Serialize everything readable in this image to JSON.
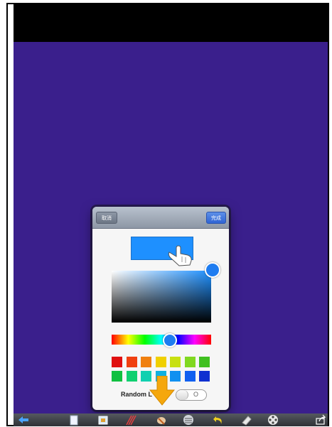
{
  "popover": {
    "cancel_label": "取消",
    "done_label": "完成",
    "selected_color": "#1e90ff",
    "random_label": "Random L",
    "toggle_state": "O"
  },
  "swatches": {
    "row1": [
      "#e01010",
      "#f04010",
      "#f08010",
      "#f0d000",
      "#c8e010",
      "#80d820",
      "#40c020"
    ],
    "row2": [
      "#10c040",
      "#10d070",
      "#10d0b0",
      "#10b0e0",
      "#1090f0",
      "#1060f0",
      "#1030d0"
    ]
  },
  "toolbar": {
    "icons": [
      "back-arrow-icon",
      "page-icon",
      "image-icon",
      "pencils-icon",
      "brush-icon",
      "line-width-icon",
      "undo-icon",
      "eraser-icon",
      "film-reel-icon",
      "share-icon"
    ]
  },
  "colors": {
    "canvas": "#3a1f8c",
    "accent": "#1e90ff",
    "arrow": "#f5a70c"
  }
}
